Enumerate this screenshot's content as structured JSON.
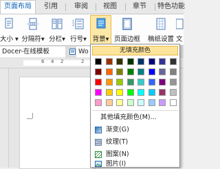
{
  "tabs": [
    "页面布局",
    "引用",
    "审阅",
    "视图",
    "章节",
    "特色功能"
  ],
  "ribbon": {
    "size_label": "大小",
    "columns_label": "分栏",
    "separator_label": "分隔符",
    "line_number_label": "行号",
    "background_label": "背景",
    "page_border_label": "页面边框",
    "draft_setting_label": "稿纸设置",
    "text_direction_label": "文"
  },
  "doc_tabs": {
    "first": "Docer-在线模板",
    "second": "Wo"
  },
  "ruler_numbers": [
    "6",
    "4",
    "2",
    "2"
  ],
  "dropdown": {
    "no_fill": "无填充颜色",
    "more_colors": "其他填充颜色(M)...",
    "items": [
      {
        "label": "渐变(G)",
        "icon": "gradient-icon"
      },
      {
        "label": "纹理(T)",
        "icon": "texture-icon"
      },
      {
        "label": "图案(N)",
        "icon": "pattern-icon"
      },
      {
        "label": "图片(I)",
        "icon": "picture-icon"
      }
    ],
    "colors": [
      [
        "#000000",
        "#993300",
        "#333300",
        "#003300",
        "#003366",
        "#000080",
        "#333399",
        "#333333"
      ],
      [
        "#800000",
        "#FF6600",
        "#808000",
        "#008000",
        "#008080",
        "#0000FF",
        "#666699",
        "#808080"
      ],
      [
        "#FF0000",
        "#FF9900",
        "#99CC00",
        "#339966",
        "#33CCCC",
        "#3366FF",
        "#800080",
        "#969696"
      ],
      [
        "#FF00FF",
        "#FFCC00",
        "#FFFF00",
        "#00FF00",
        "#00FFFF",
        "#00CCFF",
        "#993366",
        "#C0C0C0"
      ],
      [
        "#FF99CC",
        "#FFCC99",
        "#FFFF99",
        "#CCFFCC",
        "#CCFFFF",
        "#99CCFF",
        "#CC99FF",
        "#FFFFFF"
      ]
    ]
  },
  "colors": {
    "active_tab_text": "#0E63B8",
    "highlight": "#FDE49B",
    "highlight_border": "#E8B84A"
  }
}
